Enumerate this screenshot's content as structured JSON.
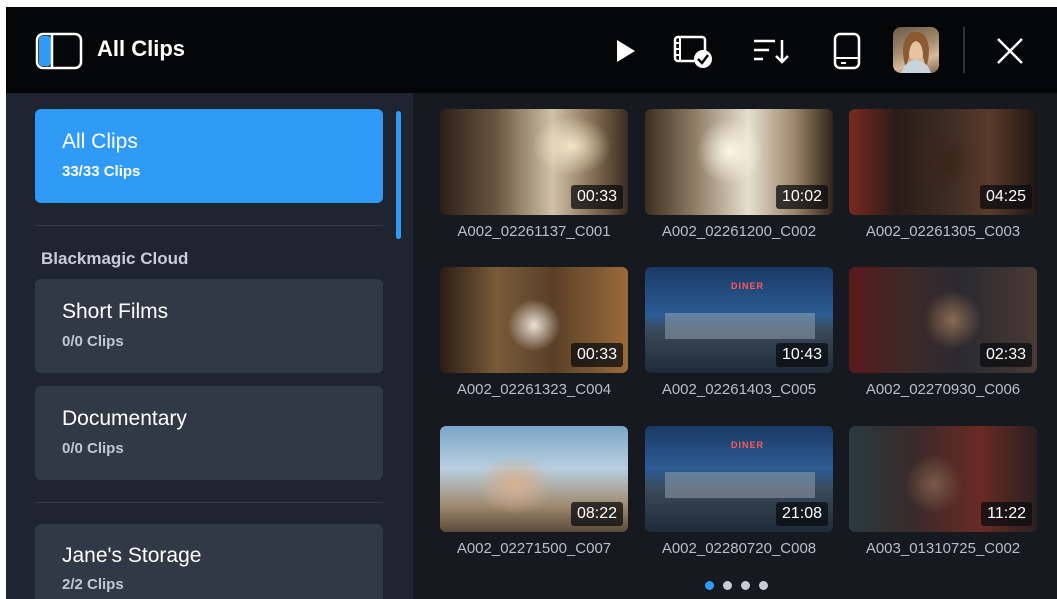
{
  "header": {
    "title": "All Clips"
  },
  "sidebar": {
    "top_item": {
      "name": "All Clips",
      "count": "33/33 Clips"
    },
    "section_label": "Blackmagic Cloud",
    "cloud_items": [
      {
        "name": "Short Films",
        "count": "0/0 Clips"
      },
      {
        "name": "Documentary",
        "count": "0/0 Clips"
      }
    ],
    "storage_item": {
      "name": "Jane's Storage",
      "count": "2/2 Clips"
    }
  },
  "clips": [
    {
      "name": "A002_02261137_C001",
      "duration": "00:33"
    },
    {
      "name": "A002_02261200_C002",
      "duration": "10:02"
    },
    {
      "name": "A002_02261305_C003",
      "duration": "04:25"
    },
    {
      "name": "A002_02261323_C004",
      "duration": "00:33"
    },
    {
      "name": "A002_02261403_C005",
      "duration": "10:43"
    },
    {
      "name": "A002_02270930_C006",
      "duration": "02:33"
    },
    {
      "name": "A002_02271500_C007",
      "duration": "08:22"
    },
    {
      "name": "A002_02280720_C008",
      "duration": "21:08"
    },
    {
      "name": "A003_01310725_C002",
      "duration": "11:22"
    }
  ],
  "thumbnail_text": {
    "diner_sign_1": "DINER",
    "diner_sign_2": "DINER"
  },
  "pager": {
    "pages": 4,
    "current": 1
  },
  "colors": {
    "accent": "#2f9bf6",
    "header_bg": "#050608",
    "sidebar_bg": "#1f2530",
    "card_bg": "#313947",
    "grid_bg": "#16191f"
  },
  "icons": {
    "sidebar_toggle": "sidebar-panel-icon",
    "play": "play-icon",
    "clip_select": "clip-checkmark-icon",
    "sort": "sort-descending-icon",
    "storage": "drive-icon",
    "close": "close-icon"
  }
}
